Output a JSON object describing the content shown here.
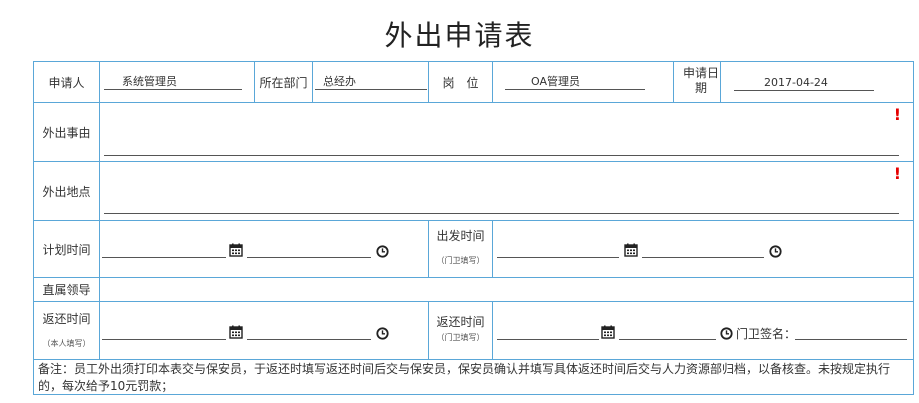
{
  "title": "外出申请表",
  "applicant": {
    "label": "申请人",
    "value": "系统管理员"
  },
  "department": {
    "label": "所在部门",
    "value": "总经办"
  },
  "position": {
    "label": "岗　位",
    "value": "OA管理员"
  },
  "apply_date": {
    "label": "申请日期",
    "value": "2017-04-24"
  },
  "reason": {
    "label": "外出事由",
    "required_mark": "!"
  },
  "location": {
    "label": "外出地点",
    "required_mark": "!"
  },
  "plan_time": {
    "label": "计划时间"
  },
  "depart_time": {
    "label": "出发时间",
    "sub": "（门卫填写）"
  },
  "direct_leader": {
    "label": "直属领导"
  },
  "return_time": {
    "label": "返还时间",
    "sub": "（本人填写）"
  },
  "return_time_guard": {
    "label": "返还时间",
    "sub": "（门卫填写）"
  },
  "guard_sign": {
    "label": "门卫签名："
  },
  "note": "备注：员工外出须打印本表交与保安员，于返还时填写返还时间后交与保安员，保安员确认并填写具体返还时间后交与人力资源部归档，以备核查。未按规定执行的，每次给予10元罚款；",
  "icons": {
    "calendar": "calendar-icon",
    "clock": "clock-icon",
    "required": "exclamation-icon"
  }
}
